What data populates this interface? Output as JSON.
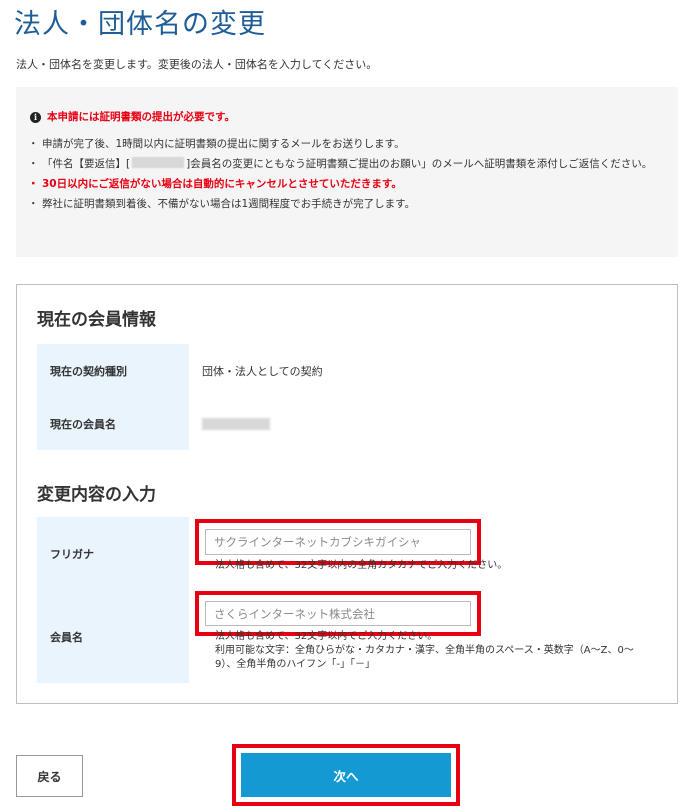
{
  "page": {
    "title": "法人・団体名の変更",
    "description": "法人・団体名を変更します。変更後の法人・団体名を入力してください。"
  },
  "notice": {
    "icon": "info-icon",
    "heading": "本申請には証明書類の提出が必要です。",
    "item1": "申請が完了後、1時間以内に証明書類の提出に関するメールをお送りします。",
    "item2_pre": "「件名【要返信】[",
    "item2_post": "]会員名の変更にともなう証明書類ご提出のお願い」のメールへ証明書類を添付しご返信ください。",
    "item3": "30日以内にご返信がない場合は自動的にキャンセルとさせていただきます。",
    "item4": "弊社に証明書類到着後、不備がない場合は1週間程度でお手続きが完了します。"
  },
  "current_info": {
    "title": "現在の会員情報",
    "contract_label": "現在の契約種別",
    "contract_value": "団体・法人としての契約",
    "name_label": "現在の会員名"
  },
  "change": {
    "title": "変更内容の入力",
    "furigana_label": "フリガナ",
    "furigana_placeholder": "サクラインターネットカブシキガイシャ",
    "furigana_hint": "法人格も含めて、32文字以内の全角カタカナでご入力ください。",
    "name_label": "会員名",
    "name_placeholder": "さくらインターネット株式会社",
    "name_hint_line1": "法人格も含めて、32文字以内でご入力ください。",
    "name_hint_line2": "利用可能な文字：全角ひらがな・カタカナ・漢字、全角半角のスペース・英数字（A～Z、0～",
    "name_hint_line3": "9）、全角半角のハイフン「-」「－」"
  },
  "buttons": {
    "back": "戻る",
    "next": "次へ"
  },
  "colors": {
    "title_blue": "#1e5d98",
    "alert_red": "#e60012",
    "primary_button": "#1599d2",
    "label_bg": "#eaf4fc",
    "notice_bg": "#f5f5f5"
  }
}
